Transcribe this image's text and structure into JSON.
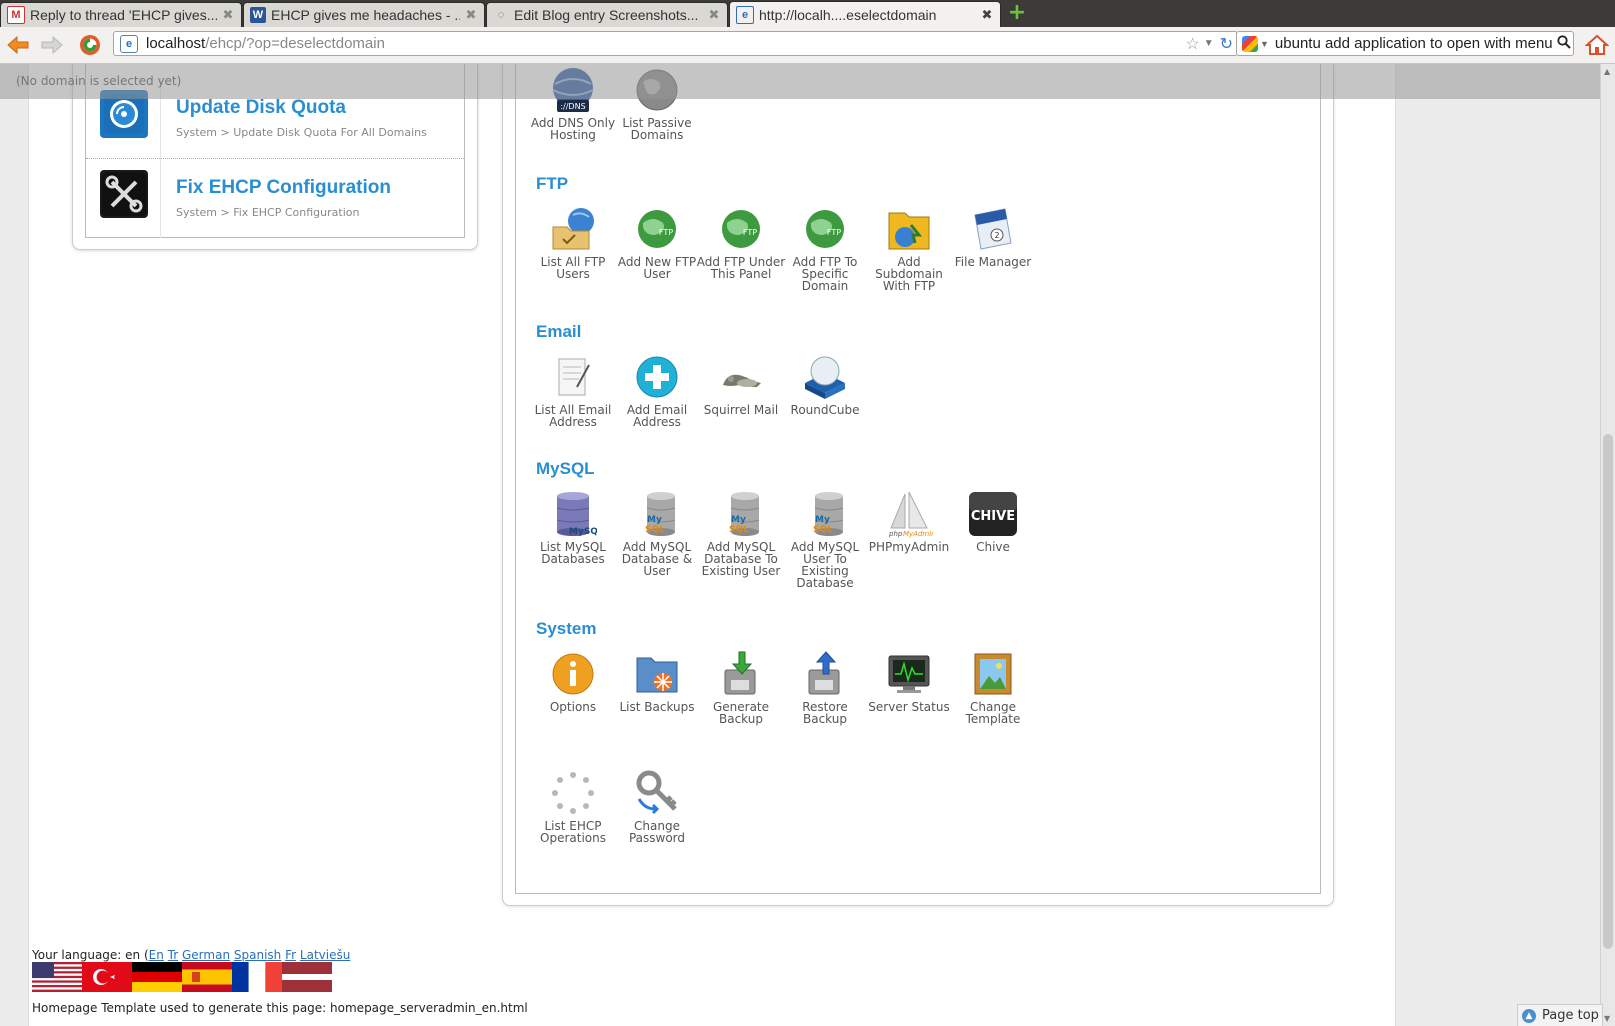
{
  "browser": {
    "tabs": [
      {
        "label": "Reply to thread 'EHCP gives...",
        "icon": "gmail-icon"
      },
      {
        "label": "EHCP gives me headaches - ...",
        "icon": "word-icon"
      },
      {
        "label": "Edit Blog entry Screenshots...",
        "icon": "loading-icon"
      },
      {
        "label": "http://localh....eselectdomain",
        "icon": "ie-icon"
      }
    ],
    "url_host": "localhost",
    "url_path": "/ehcp/?op=deselectdomain",
    "search_value": "ubuntu add application to open with menu"
  },
  "top_notice": "(No domain is selected yet)",
  "left_panel": {
    "items": [
      {
        "title": "Update Disk Quota",
        "sub": "System > Update Disk Quota For All Domains",
        "icon": "disk-quota-icon"
      },
      {
        "title": "Fix EHCP Configuration",
        "sub": "System > Fix EHCP Configuration",
        "icon": "tools-icon"
      }
    ]
  },
  "sections": {
    "dns": {
      "items": [
        {
          "label": "Add DNS Only Hosting",
          "icon": "dns-globe-icon"
        },
        {
          "label": "List Passive Domains",
          "icon": "gray-globe-icon"
        }
      ]
    },
    "ftp": {
      "title": "FTP",
      "items": [
        {
          "label": "List All FTP Users",
          "icon": "ftp-folder-icon"
        },
        {
          "label": "Add New FTP User",
          "icon": "ftp-globe-icon"
        },
        {
          "label": "Add FTP Under This Panel",
          "icon": "ftp-globe-icon"
        },
        {
          "label": "Add FTP To Specific Domain",
          "icon": "ftp-globe-icon"
        },
        {
          "label": "Add Subdomain With FTP",
          "icon": "subdomain-folder-icon"
        },
        {
          "label": "File Manager",
          "icon": "file-manager-icon"
        }
      ]
    },
    "email": {
      "title": "Email",
      "items": [
        {
          "label": "List All Email Address",
          "icon": "email-list-icon"
        },
        {
          "label": "Add Email Address",
          "icon": "add-email-icon"
        },
        {
          "label": "Squirrel Mail",
          "icon": "squirrel-icon"
        },
        {
          "label": "RoundCube",
          "icon": "roundcube-icon"
        }
      ]
    },
    "mysql": {
      "title": "MySQL",
      "items": [
        {
          "label": "List MySQL Databases",
          "icon": "mysql-database-icon"
        },
        {
          "label": "Add MySQL Database & User",
          "icon": "mysql-add-icon"
        },
        {
          "label": "Add MySQL Database To Existing User",
          "icon": "mysql-add-icon"
        },
        {
          "label": "Add MySQL User To Existing Database",
          "icon": "mysql-add-icon"
        },
        {
          "label": "PHPmyAdmin",
          "icon": "phpmyadmin-icon"
        },
        {
          "label": "Chive",
          "icon": "chive-icon"
        }
      ]
    },
    "system": {
      "title": "System",
      "items": [
        {
          "label": "Options",
          "icon": "info-icon"
        },
        {
          "label": "List Backups",
          "icon": "backup-folder-icon"
        },
        {
          "label": "Generate Backup",
          "icon": "generate-backup-icon"
        },
        {
          "label": "Restore Backup",
          "icon": "restore-backup-icon"
        },
        {
          "label": "Server Status",
          "icon": "monitor-icon"
        },
        {
          "label": "Change Template",
          "icon": "template-icon"
        },
        {
          "label": "List EHCP Operations",
          "icon": "spinner-icon"
        },
        {
          "label": "Change Password",
          "icon": "key-icon"
        }
      ]
    }
  },
  "footer": {
    "language_prefix": "Your language: en (",
    "language_links": [
      "En",
      "Tr",
      "German",
      "Spanish",
      "Fr",
      "Latviešu"
    ],
    "template_line": "Homepage Template used to generate this page: homepage_serveradmin_en.html"
  },
  "page_top_label": "Page top"
}
